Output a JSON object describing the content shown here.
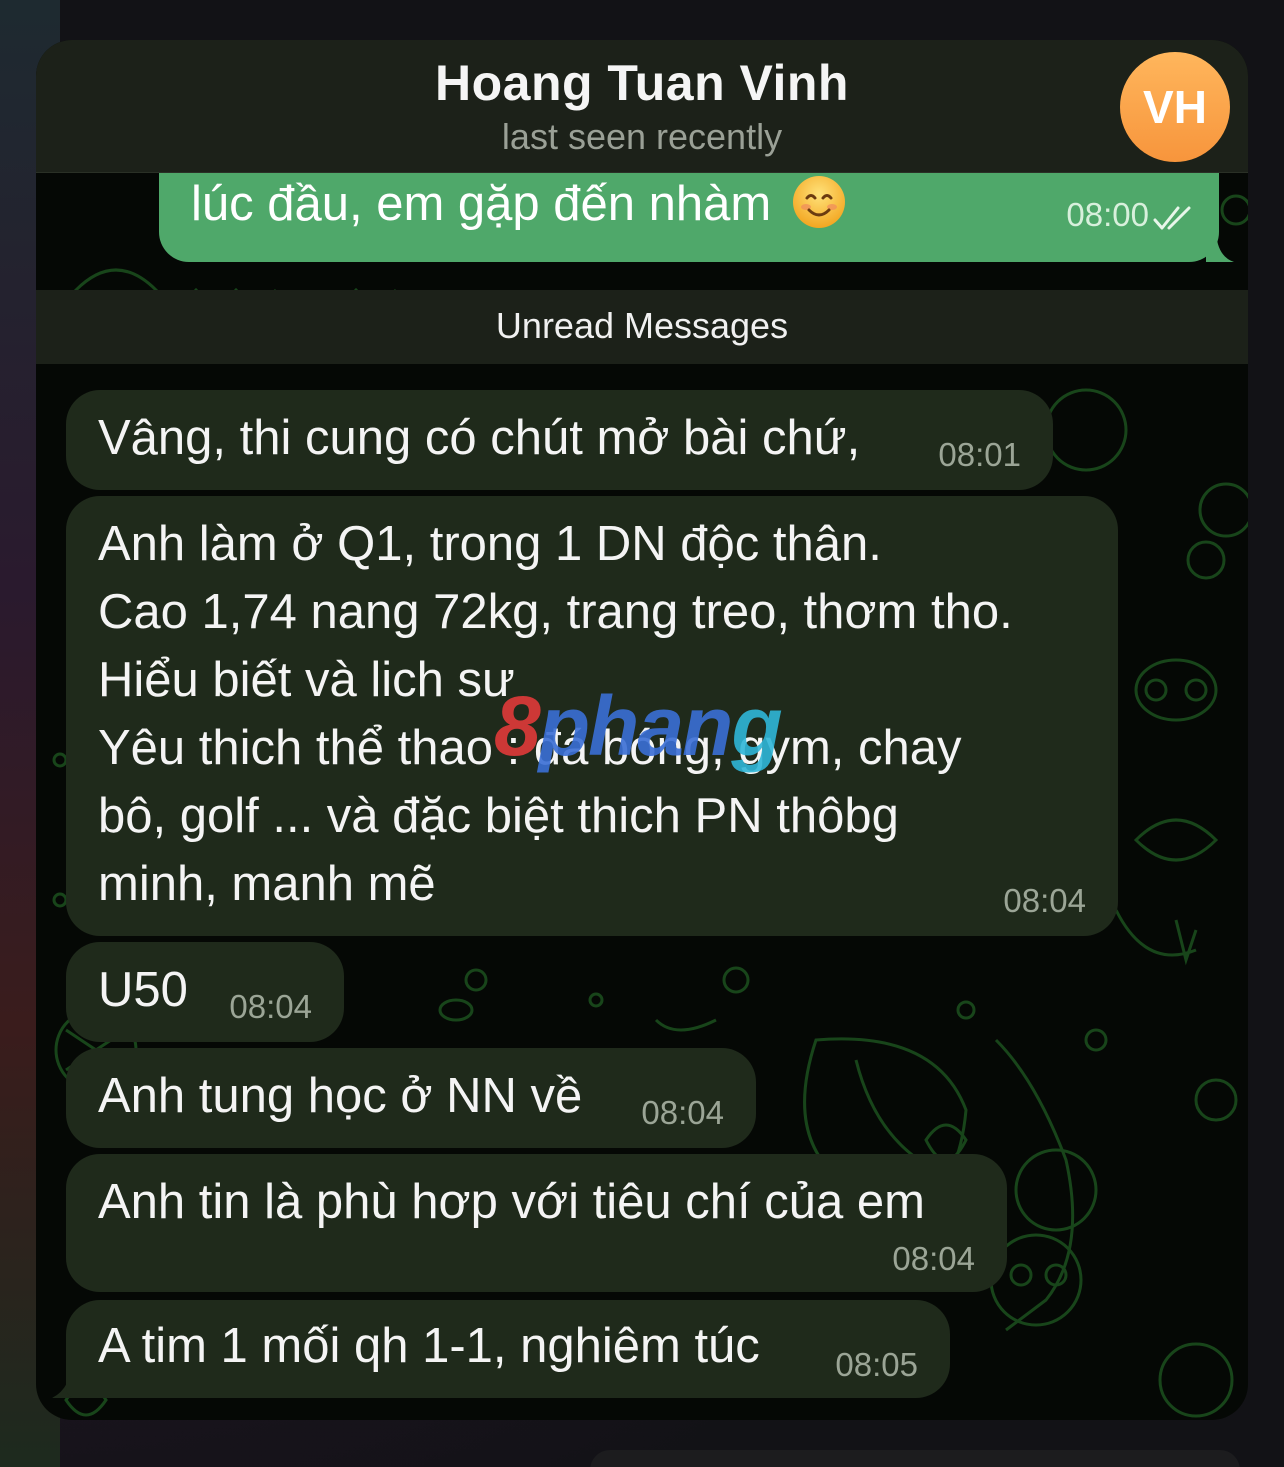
{
  "header": {
    "title": "Hoang Tuan Vinh",
    "subtitle": "last seen recently",
    "avatar_initials": "VH",
    "avatar_color": "#f7953c"
  },
  "outgoing": {
    "text": "lúc đầu, em gặp đến nhàm",
    "emoji": "smiling-face-icon",
    "time": "08:00",
    "status_icon": "double-check-icon",
    "bubble_color": "#4fa86a"
  },
  "divider": {
    "label": "Unread Messages"
  },
  "messages": [
    {
      "lines": [
        "Vâng, thi cung có chút mở bài chứ,"
      ],
      "time": "08:01"
    },
    {
      "lines": [
        "Anh làm ở Q1, trong 1 DN độc thân.",
        "Cao 1,74 nang 72kg, trang treo, thơm tho.",
        "Hiểu biết và lich sư",
        "Yêu thich thể thao : đá bóng, gym, chay",
        "bô, golf ... và đặc biệt thich PN thôbg",
        "minh, manh mẽ"
      ],
      "time": "08:04"
    },
    {
      "lines": [
        "U50"
      ],
      "time": "08:04"
    },
    {
      "lines": [
        "Anh tung học ở NN về"
      ],
      "time": "08:04"
    },
    {
      "lines": [
        "Anh tin là phù hơp với tiêu chí của em"
      ],
      "time": "08:04"
    },
    {
      "lines": [
        "A tim 1 mối qh 1-1, nghiêm túc"
      ],
      "time": "08:05"
    }
  ],
  "watermark": {
    "part1": "8",
    "part2": "phan",
    "part3": "g"
  },
  "colors": {
    "incoming_bubble": "#1f2a1b",
    "header_bg": "#1c2119",
    "wallpaper_line": "#2d6b2a"
  }
}
